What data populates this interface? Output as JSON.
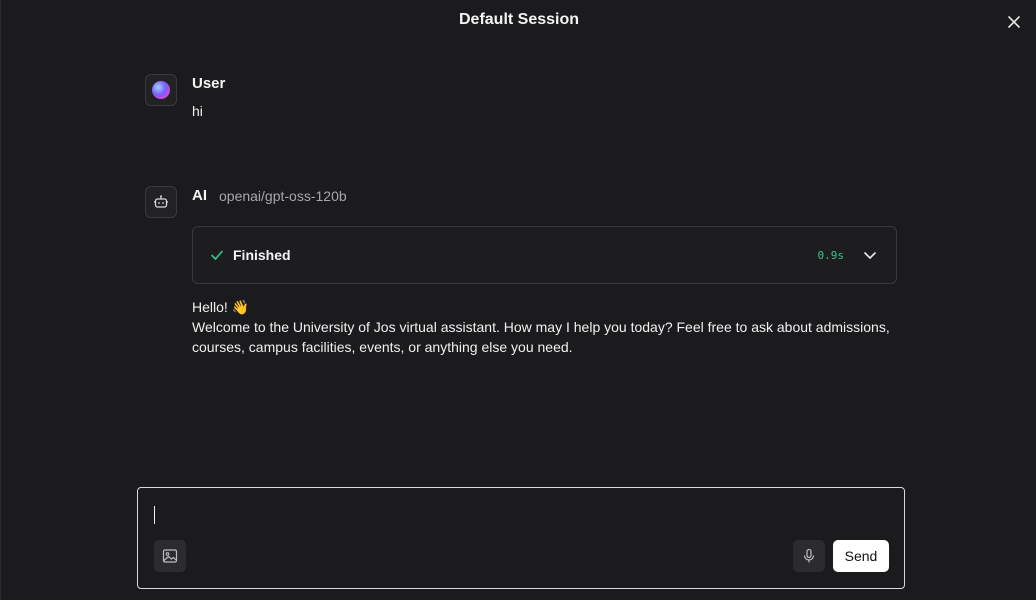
{
  "window": {
    "title": "Default Session",
    "close_icon": "close-icon"
  },
  "messages": {
    "user": {
      "sender": "User",
      "avatar_icon": "user-avatar-icon",
      "text": "hi"
    },
    "ai": {
      "sender": "AI",
      "model": "openai/gpt-oss-120b",
      "avatar_icon": "bot-icon",
      "status": {
        "label": "Finished",
        "duration": "0.9s",
        "check_icon": "check-icon",
        "expand_icon": "chevron-down-icon",
        "duration_color": "#35c48a"
      },
      "lines": [
        "Hello! 👋",
        "Welcome to the University of Jos virtual assistant. How may I help you today? Feel free to ask about admissions, courses, campus facilities, events, or anything else you need."
      ]
    }
  },
  "composer": {
    "value": "",
    "placeholder": "",
    "image_icon": "image-icon",
    "mic_icon": "microphone-icon",
    "send_label": "Send"
  }
}
